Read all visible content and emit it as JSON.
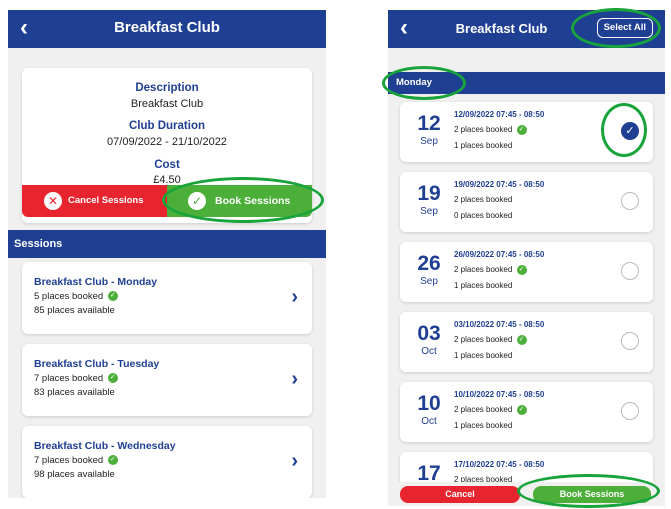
{
  "colors": {
    "header": "#1f3f93",
    "accent_green": "#4caf3a",
    "cancel_red": "#e8252e",
    "annotation": "#18a33b"
  },
  "left": {
    "header": {
      "back_icon": "chevron-left-icon",
      "title": "Breakfast Club"
    },
    "details": {
      "description_label": "Description",
      "description_value": "Breakfast Club",
      "duration_label": "Club Duration",
      "duration_value": "07/09/2022 - 21/10/2022",
      "cost_label": "Cost",
      "cost_value": "£4.50"
    },
    "actions": {
      "cancel_label": "Cancel Sessions",
      "book_label": "Book Sessions"
    },
    "sessions_heading": "Sessions",
    "sessions": [
      {
        "title": "Breakfast Club - Monday",
        "booked": "5 places booked",
        "available": "85 places available"
      },
      {
        "title": "Breakfast Club - Tuesday",
        "booked": "7 places booked",
        "available": "83 places available"
      },
      {
        "title": "Breakfast Club - Wednesday",
        "booked": "7 places booked",
        "available": "98 places available"
      }
    ]
  },
  "right": {
    "header": {
      "back_icon": "chevron-left-icon",
      "title": "Breakfast Club",
      "select_all_label": "Select All"
    },
    "day_heading": "Monday",
    "dates": [
      {
        "day": "12",
        "month": "Sep",
        "datetime": "12/09/2022 07:45 - 08:50",
        "booked": "2 places booked",
        "mine": "1 places booked",
        "selected": true
      },
      {
        "day": "19",
        "month": "Sep",
        "datetime": "19/09/2022 07:45 - 08:50",
        "booked": "2 places booked",
        "mine": "0 places booked",
        "selected": false
      },
      {
        "day": "26",
        "month": "Sep",
        "datetime": "26/09/2022 07:45 - 08:50",
        "booked": "2 places booked",
        "mine": "1 places booked",
        "selected": false
      },
      {
        "day": "03",
        "month": "Oct",
        "datetime": "03/10/2022 07:45 - 08:50",
        "booked": "2 places booked",
        "mine": "1 places booked",
        "selected": false
      },
      {
        "day": "10",
        "month": "Oct",
        "datetime": "10/10/2022 07:45 - 08:50",
        "booked": "2 places booked",
        "mine": "1 places booked",
        "selected": false
      },
      {
        "day": "17",
        "month": "",
        "datetime": "17/10/2022 07:45 - 08:50",
        "booked": "2 places booked",
        "mine": "",
        "selected": false
      }
    ],
    "actions": {
      "cancel_label": "Cancel",
      "book_label": "Book Sessions"
    }
  }
}
